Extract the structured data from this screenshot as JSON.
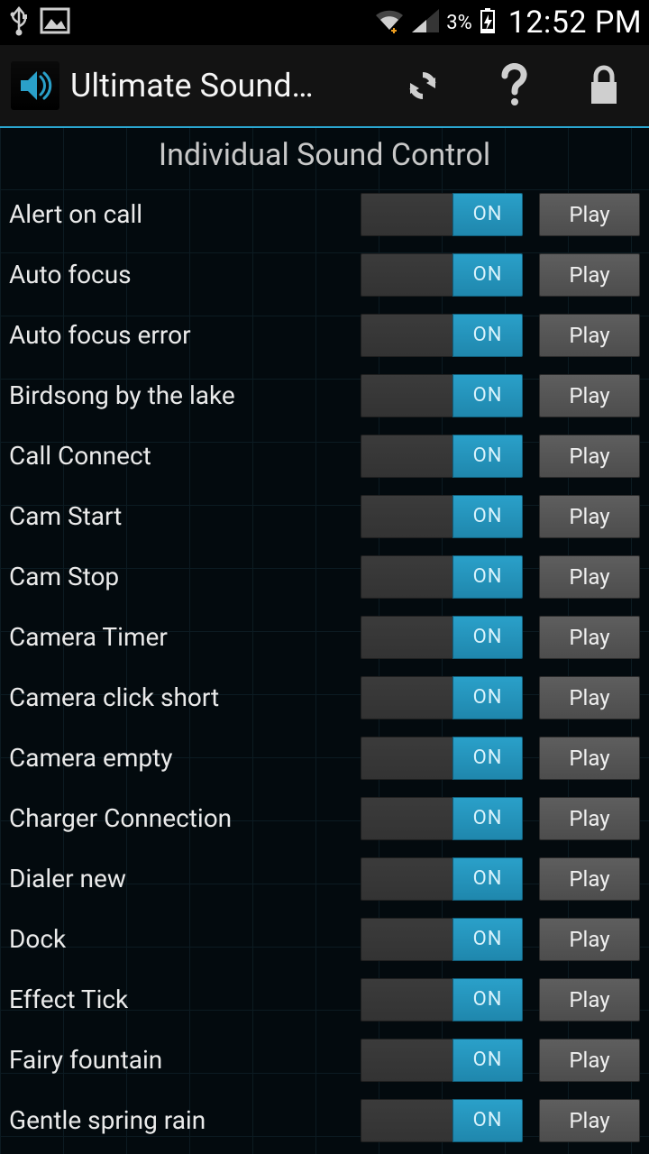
{
  "status": {
    "battery_pct": "3%",
    "time": "12:52 PM"
  },
  "header": {
    "app_title": "Ultimate Sound…"
  },
  "page": {
    "title": "Individual Sound Control"
  },
  "controls": {
    "toggle_on_label": "ON",
    "play_label": "Play"
  },
  "sounds": [
    {
      "label": "Alert on call"
    },
    {
      "label": "Auto focus"
    },
    {
      "label": "Auto focus error"
    },
    {
      "label": "Birdsong by the lake"
    },
    {
      "label": "Call Connect"
    },
    {
      "label": "Cam Start"
    },
    {
      "label": "Cam Stop"
    },
    {
      "label": "Camera Timer"
    },
    {
      "label": "Camera click short"
    },
    {
      "label": "Camera empty"
    },
    {
      "label": "Charger Connection"
    },
    {
      "label": "Dialer new"
    },
    {
      "label": "Dock"
    },
    {
      "label": "Effect Tick"
    },
    {
      "label": "Fairy fountain"
    },
    {
      "label": "Gentle spring rain"
    }
  ]
}
